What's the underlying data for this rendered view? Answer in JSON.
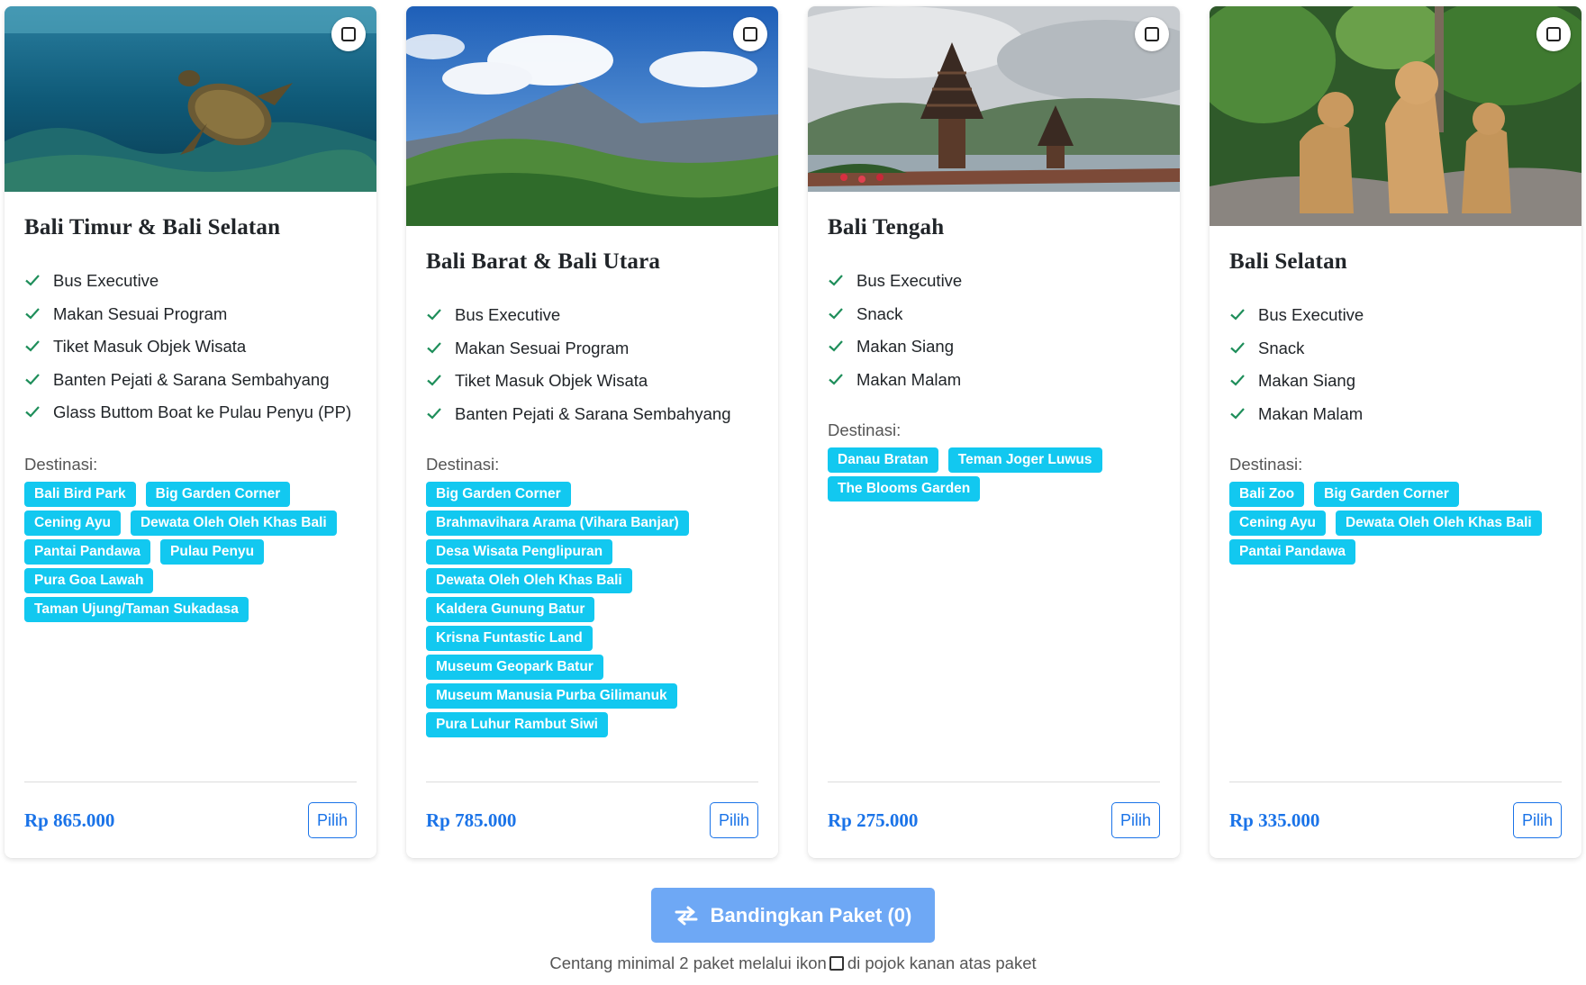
{
  "packages": [
    {
      "title": "Bali Timur & Bali Selatan",
      "features": [
        "Bus Executive",
        "Makan Sesuai Program",
        "Tiket Masuk Objek Wisata",
        "Banten Pejati & Sarana Sembahyang",
        "Glass Buttom Boat ke Pulau Penyu (PP)"
      ],
      "destinations_label": "Destinasi:",
      "destinations": [
        "Bali Bird Park",
        "Big Garden Corner",
        "Cening Ayu",
        "Dewata Oleh Oleh Khas Bali",
        "Pantai Pandawa",
        "Pulau Penyu",
        "Pura Goa Lawah",
        "Taman Ujung/Taman Sukadasa"
      ],
      "price": "Rp 865.000",
      "button": "Pilih",
      "image": "sea-turtle-underwater"
    },
    {
      "title": "Bali Barat & Bali Utara",
      "features": [
        "Bus Executive",
        "Makan Sesuai Program",
        "Tiket Masuk Objek Wisata",
        "Banten Pejati & Sarana Sembahyang"
      ],
      "destinations_label": "Destinasi:",
      "destinations": [
        "Big Garden Corner",
        "Brahmavihara Arama (Vihara Banjar)",
        "Desa Wisata Penglipuran",
        "Dewata Oleh Oleh Khas Bali",
        "Kaldera Gunung Batur",
        "Krisna Funtastic Land",
        "Museum Geopark Batur",
        "Museum Manusia Purba Gilimanuk",
        "Pura Luhur Rambut Siwi"
      ],
      "price": "Rp 785.000",
      "button": "Pilih",
      "image": "mount-batur-landscape"
    },
    {
      "title": "Bali Tengah",
      "features": [
        "Bus Executive",
        "Snack",
        "Makan Siang",
        "Makan Malam"
      ],
      "destinations_label": "Destinasi:",
      "destinations": [
        "Danau Bratan",
        "Teman Joger Luwus",
        "The Blooms Garden"
      ],
      "price": "Rp 275.000",
      "button": "Pilih",
      "image": "ulun-danu-temple"
    },
    {
      "title": "Bali Selatan",
      "features": [
        "Bus Executive",
        "Snack",
        "Makan Siang",
        "Makan Malam"
      ],
      "destinations_label": "Destinasi:",
      "destinations": [
        "Bali Zoo",
        "Big Garden Corner",
        "Cening Ayu",
        "Dewata Oleh Oleh Khas Bali",
        "Pantai Pandawa"
      ],
      "price": "Rp 335.000",
      "button": "Pilih",
      "image": "lions-zoo"
    }
  ],
  "compare": {
    "label": "Bandingkan Paket (0)",
    "hint_before": "Centang minimal 2 paket melalui ikon",
    "hint_after": "di pojok kanan atas paket"
  },
  "colors": {
    "accent": "#1a73e8",
    "tag": "#12c8f0",
    "check": "#1e8e5a",
    "compare_button": "#6ea8f5"
  }
}
